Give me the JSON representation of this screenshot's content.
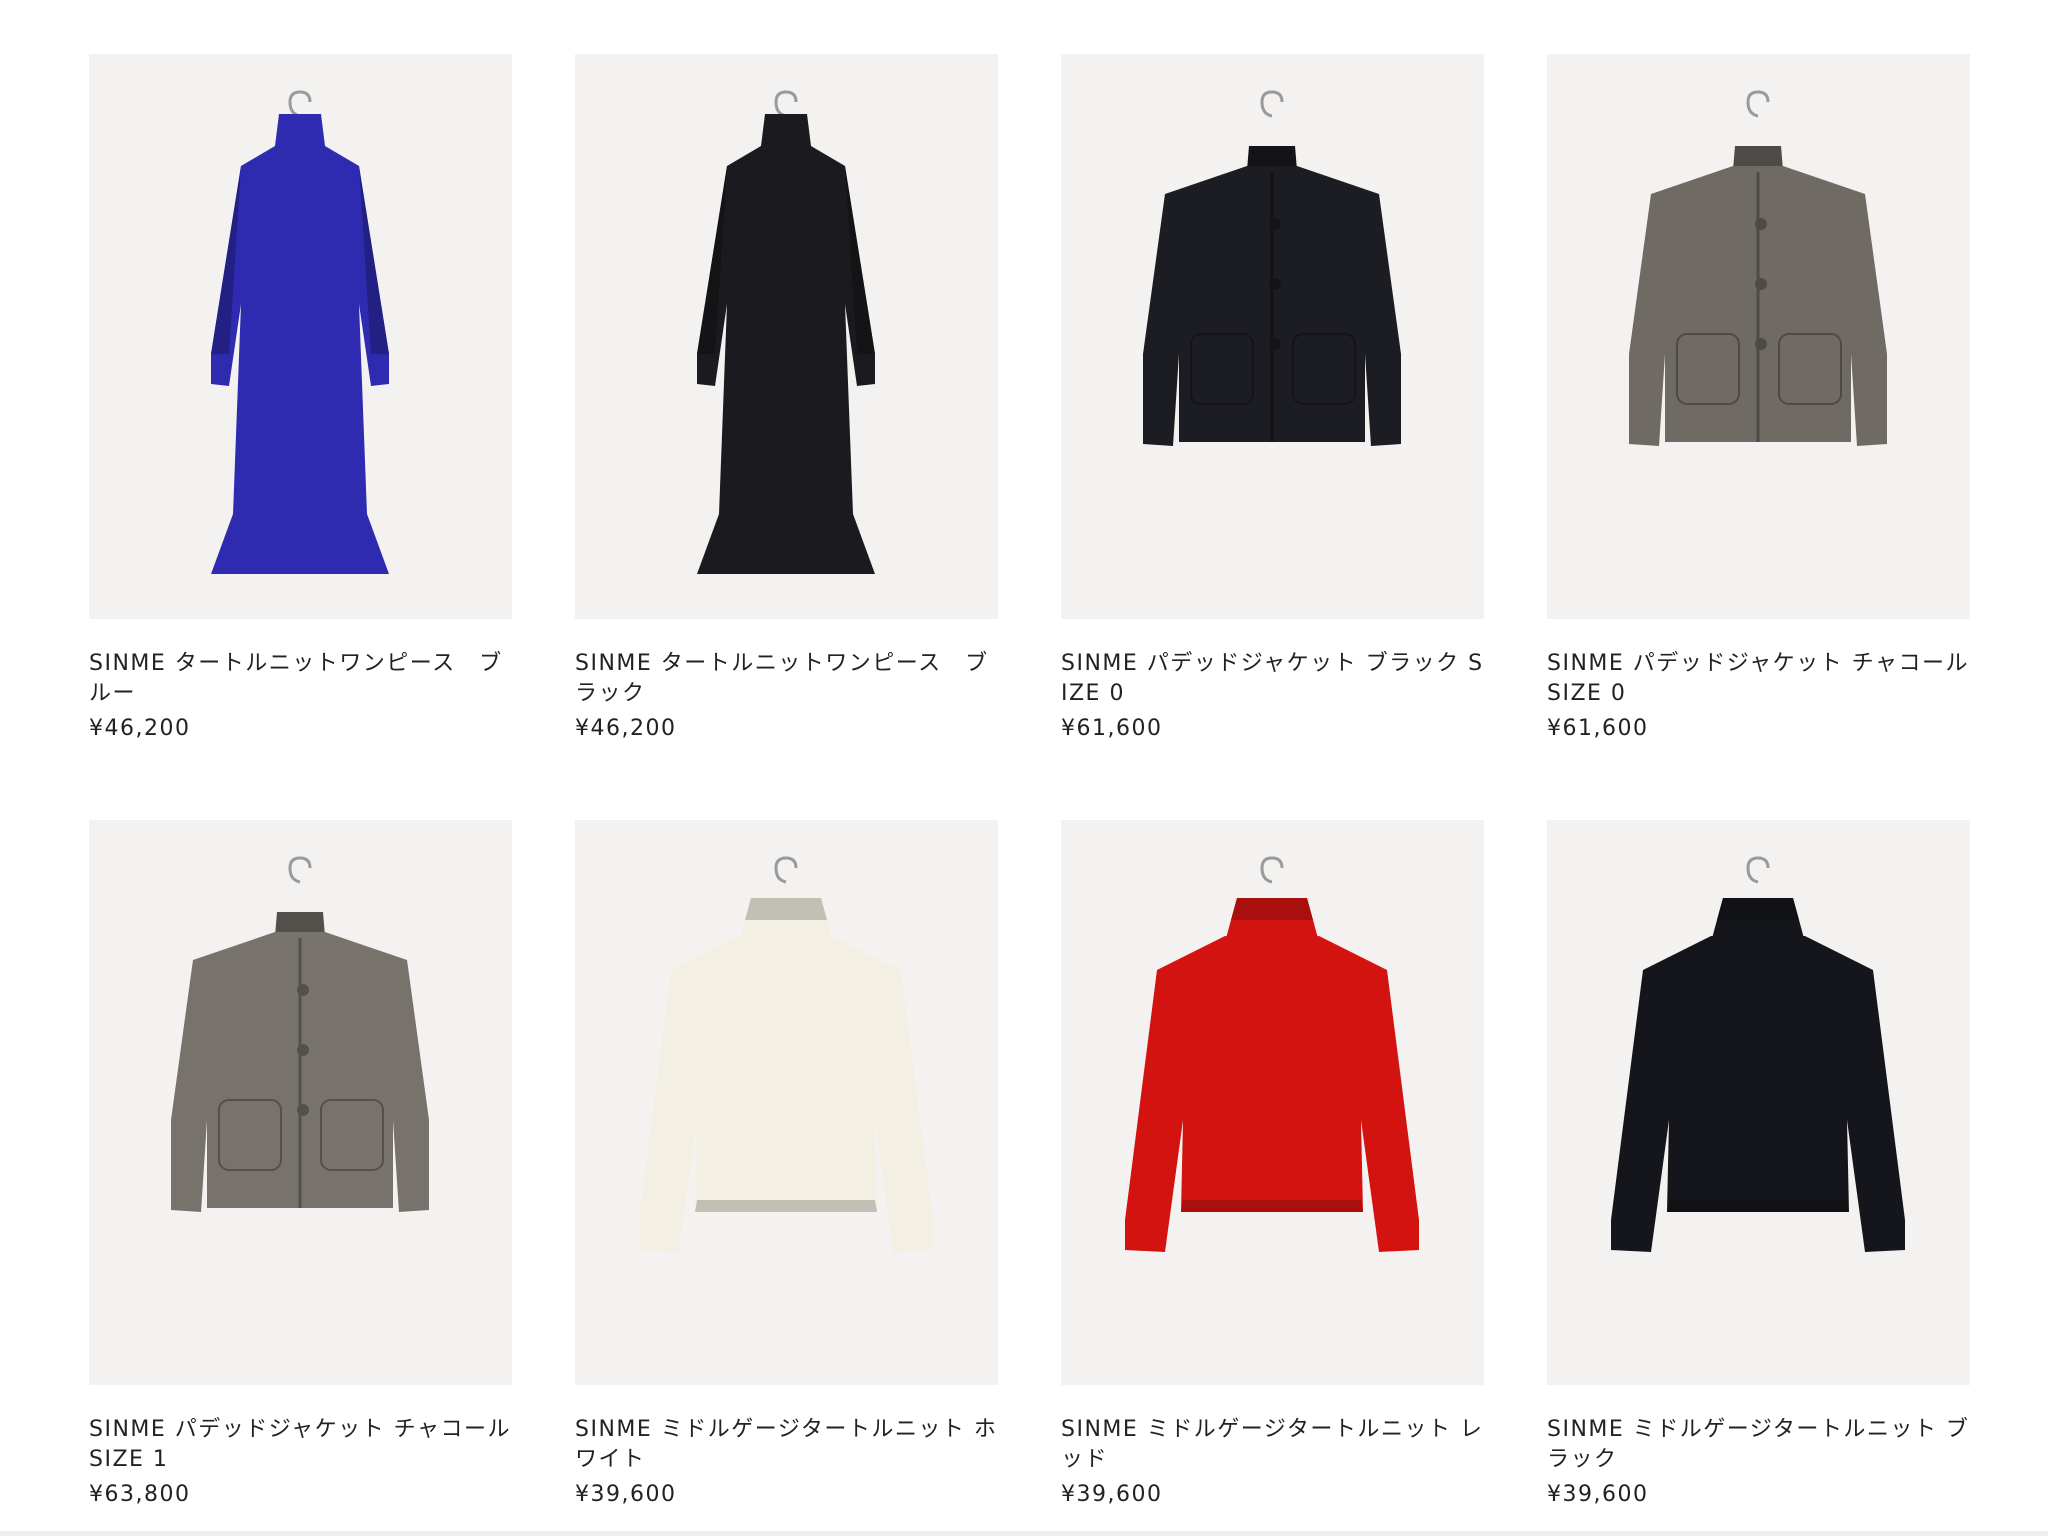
{
  "products": [
    {
      "name": "SINME タートルニットワンピース　ブルー",
      "price": "¥46,200",
      "color": "#2f2bb0",
      "garment": "dress-icon"
    },
    {
      "name": "SINME タートルニットワンピース　ブラック",
      "price": "¥46,200",
      "color": "#1b1a1e",
      "garment": "dress-icon"
    },
    {
      "name": "SINME パデッドジャケット ブラック SIZE 0",
      "price": "¥61,600",
      "color": "#1c1d22",
      "garment": "jacket-icon"
    },
    {
      "name": "SINME パデッドジャケット チャコール　SIZE 0",
      "price": "¥61,600",
      "color": "#6f6a64",
      "garment": "jacket-icon"
    },
    {
      "name": "SINME パデッドジャケット チャコール　SIZE 1",
      "price": "¥63,800",
      "color": "#77726b",
      "garment": "jacket-icon"
    },
    {
      "name": "SINME ミドルゲージタートルニット ホワイト",
      "price": "¥39,600",
      "color": "#f3efe2",
      "garment": "sweater-icon"
    },
    {
      "name": "SINME ミドルゲージタートルニット レッド",
      "price": "¥39,600",
      "color": "#d3130f",
      "garment": "sweater-icon"
    },
    {
      "name": "SINME ミドルゲージタートルニット ブラック",
      "price": "¥39,600",
      "color": "#15161c",
      "garment": "sweater-icon"
    }
  ]
}
